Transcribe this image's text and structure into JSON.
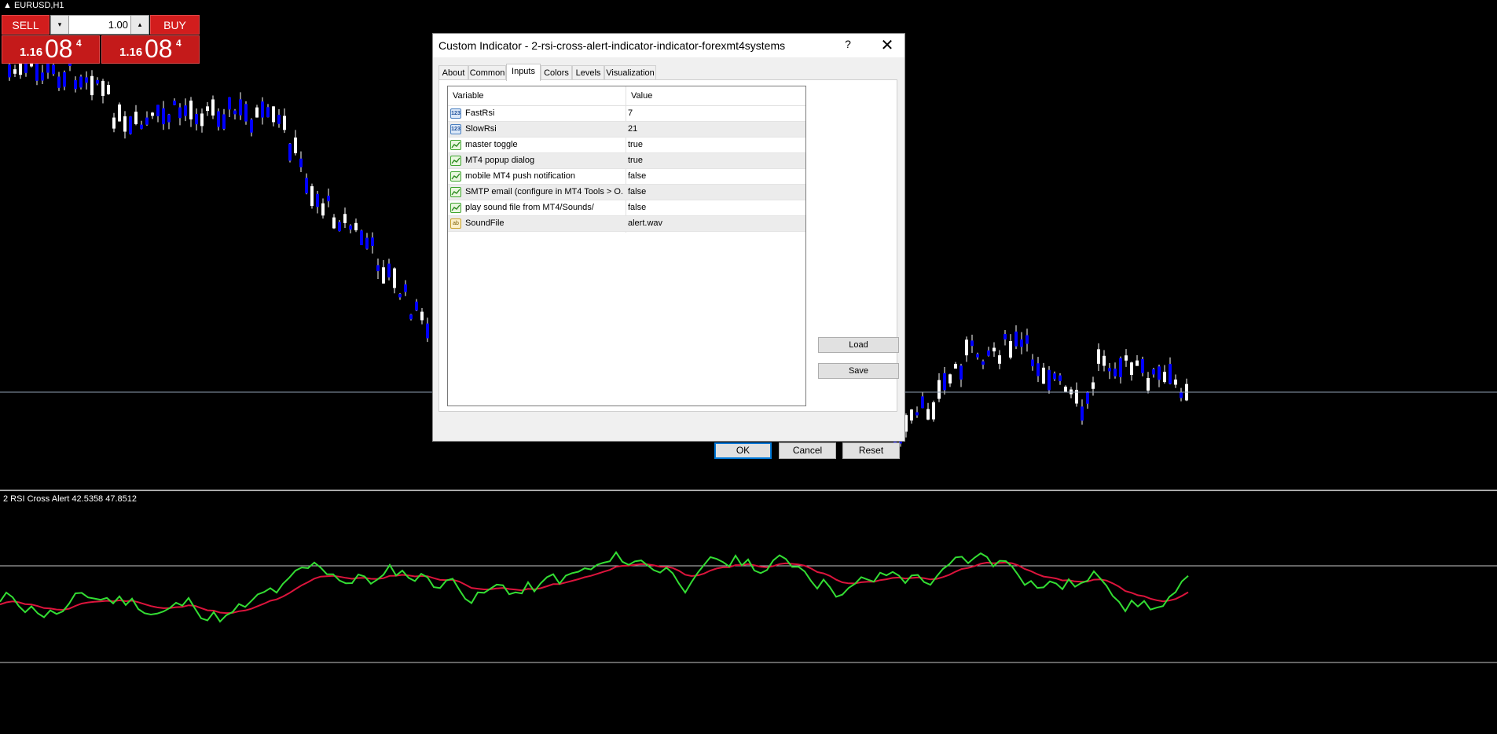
{
  "chart": {
    "symbol_timeframe": "EURUSD,H1",
    "indicator_label": "2 RSI Cross Alert 42.5358 47.8512",
    "colors": {
      "background": "#000000",
      "bull_candle": "#ffffff",
      "bear_candle": "#0000ff",
      "fast_rsi": "#33dd33",
      "slow_rsi": "#dc143c",
      "level_lines": "#c8c8c8"
    }
  },
  "trade_panel": {
    "sell_label": "SELL",
    "buy_label": "BUY",
    "lot_value": "1.00",
    "down_arrow": "▾",
    "up_arrow": "▴",
    "sell_price": {
      "prefix": "1.16",
      "big": "08",
      "sup": "4"
    },
    "buy_price": {
      "prefix": "1.16",
      "big": "08",
      "sup": "4"
    }
  },
  "dialog": {
    "title": "Custom Indicator - 2-rsi-cross-alert-indicator-indicator-forexmt4systems",
    "help_label": "?",
    "close_label": "✕",
    "tabs": [
      "About",
      "Common",
      "Inputs",
      "Colors",
      "Levels",
      "Visualization"
    ],
    "active_tab": "Inputs",
    "columns": {
      "variable": "Variable",
      "value": "Value"
    },
    "inputs": [
      {
        "type_icon": "num-icon",
        "icon_text": "123",
        "name": "FastRsi",
        "value": "7"
      },
      {
        "type_icon": "num-icon",
        "icon_text": "123",
        "name": "SlowRsi",
        "value": "21"
      },
      {
        "type_icon": "bool-icon",
        "icon_text": "",
        "name": "master toggle",
        "value": "true"
      },
      {
        "type_icon": "bool-icon",
        "icon_text": "",
        "name": "MT4 popup dialog",
        "value": "true"
      },
      {
        "type_icon": "bool-icon",
        "icon_text": "",
        "name": "mobile MT4 push notification",
        "value": "false"
      },
      {
        "type_icon": "bool-icon",
        "icon_text": "",
        "name": "SMTP email (configure in MT4 Tools > O...",
        "value": "false"
      },
      {
        "type_icon": "bool-icon",
        "icon_text": "",
        "name": "play sound file from MT4/Sounds/",
        "value": "false"
      },
      {
        "type_icon": "str-icon",
        "icon_text": "ab",
        "name": "SoundFile",
        "value": "alert.wav"
      }
    ],
    "load_label": "Load",
    "save_label": "Save",
    "ok_label": "OK",
    "cancel_label": "Cancel",
    "reset_label": "Reset"
  }
}
